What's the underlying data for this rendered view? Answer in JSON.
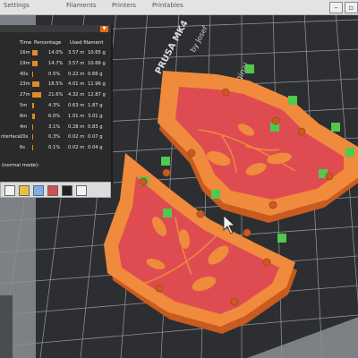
{
  "tabs": [
    "Settings",
    "Filaments",
    "Printers",
    "Printables"
  ],
  "window_controls": [
    "minimize",
    "restore"
  ],
  "bed_label_bottom": "PRUSA MK4",
  "bed_label_top": "Original",
  "bed_brand": "by Josef",
  "stats_panel": {
    "columns": [
      "Time",
      "Percentage",
      "Used filament"
    ],
    "rows": [
      {
        "label": "",
        "time": "16m",
        "percentage": "14.0%",
        "length": "3.57 m",
        "weight": "10.65 g",
        "fraction": 0.14
      },
      {
        "label": "",
        "time": "19m",
        "percentage": "14.7%",
        "length": "3.57 m",
        "weight": "10.66 g",
        "fraction": 0.147
      },
      {
        "label": "",
        "time": "40s",
        "percentage": "0.5%",
        "length": "0.22 m",
        "weight": "0.66 g",
        "fraction": 0.005
      },
      {
        "label": "",
        "time": "23m",
        "percentage": "18.5%",
        "length": "4.01 m",
        "weight": "11.96 g",
        "fraction": 0.185
      },
      {
        "label": "",
        "time": "27m",
        "percentage": "21.6%",
        "length": "4.32 m",
        "weight": "12.87 g",
        "fraction": 0.216
      },
      {
        "label": "",
        "time": "5m",
        "percentage": "4.3%",
        "length": "0.63 m",
        "weight": "1.87 g",
        "fraction": 0.043
      },
      {
        "label": "",
        "time": "8m",
        "percentage": "6.0%",
        "length": "1.01 m",
        "weight": "3.01 g",
        "fraction": 0.06
      },
      {
        "label": "",
        "time": "4m",
        "percentage": "3.1%",
        "length": "0.28 m",
        "weight": "0.83 g",
        "fraction": 0.031
      },
      {
        "label": "nterface",
        "time": "20s",
        "percentage": "0.3%",
        "length": "0.02 m",
        "weight": "0.07 g",
        "fraction": 0.003
      },
      {
        "label": "",
        "time": "6s",
        "percentage": "0.1%",
        "length": "0.02 m",
        "weight": "0.04 g",
        "fraction": 0.001
      }
    ],
    "side_labels": [
      "lm",
      "",
      "lm",
      "",
      "le",
      "",
      "m",
      "",
      "nterface",
      ""
    ],
    "legend_title": "(normal mode):"
  },
  "colors": {
    "bed": "#2d2e31",
    "grid": "#8d8f94",
    "part_wall": "#f08a3c",
    "part_fill": "#de4c52",
    "support": "#4fc94f",
    "accent": "#e08a2e"
  },
  "toolbar_icons": [
    "layers-icon",
    "arrange-icon",
    "color-icon",
    "settings-icon",
    "cut-icon",
    "cube-icon"
  ]
}
